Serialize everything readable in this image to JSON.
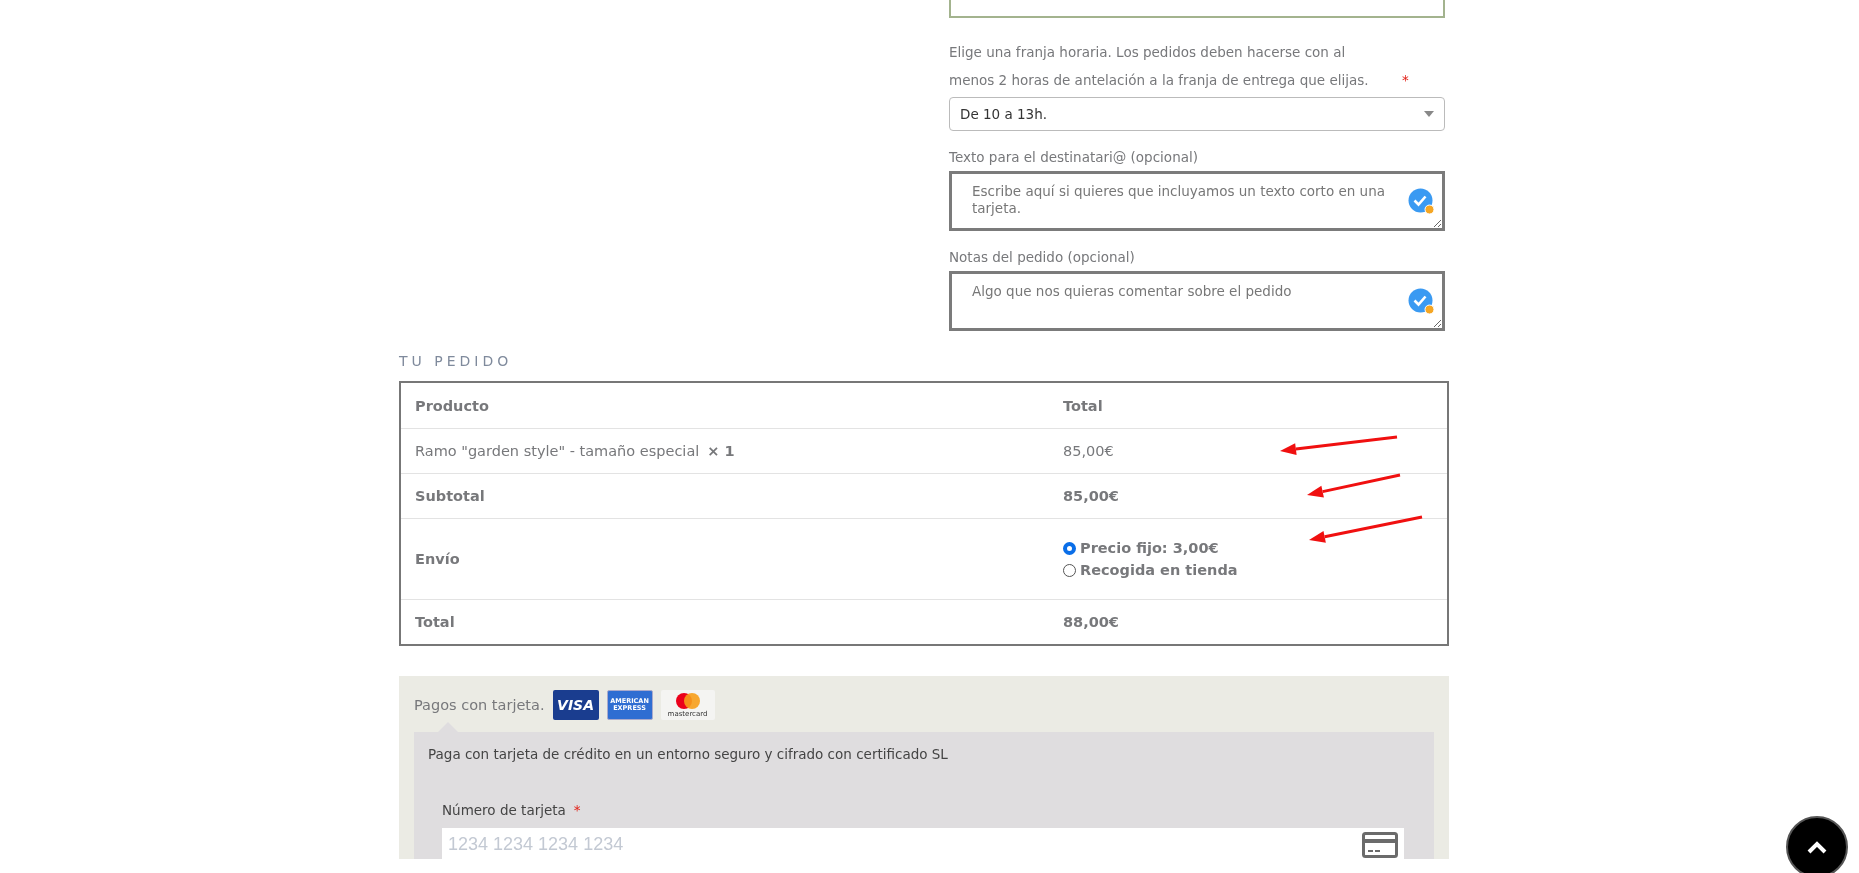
{
  "delivery_form": {
    "time_slot": {
      "label": "Elige una franja horaria. Los pedidos deben hacerse con al menos 2 horas de antelación a la franja de entrega que elijas.",
      "required_mark": "*",
      "value": "De 10 a 13h."
    },
    "fields": [
      {
        "label": "Texto para el destinatari@ (opcional)",
        "placeholder": "Escribe aquí si quieres que incluyamos un texto corto en una tarjeta."
      },
      {
        "label": "Notas del pedido (opcional)",
        "placeholder": "Algo que nos quieras comentar sobre el pedido"
      }
    ]
  },
  "order": {
    "heading": "TU PEDIDO",
    "columns": [
      "Producto",
      "Total"
    ],
    "rows": [
      {
        "kind": "item",
        "product": "Ramo \"garden style\" - tamaño especial",
        "quantity": "× 1",
        "total": "85,00€"
      },
      {
        "kind": "subtotal",
        "label": "Subtotal",
        "total": "85,00€"
      },
      {
        "kind": "shipping",
        "label": "Envío",
        "options": [
          {
            "label": "Precio fijo: 3,00€",
            "selected": true
          },
          {
            "label": "Recogida en tienda",
            "selected": false
          }
        ]
      },
      {
        "kind": "total",
        "label": "Total",
        "total": "88,00€"
      }
    ]
  },
  "payment": {
    "method": "Pagos con tarjeta.",
    "card_logos": [
      {
        "kind": "visa",
        "text": "VISA"
      },
      {
        "kind": "amex",
        "text": "AMERICAN EXPRESS"
      },
      {
        "kind": "mastercard",
        "text": "mastercard"
      }
    ],
    "description": "Paga con tarjeta de crédito en un entorno seguro y cifrado con certificado SL",
    "card_number": {
      "label": "Número de tarjeta",
      "required_mark": "*",
      "placeholder": "1234 1234 1234 1234"
    }
  }
}
